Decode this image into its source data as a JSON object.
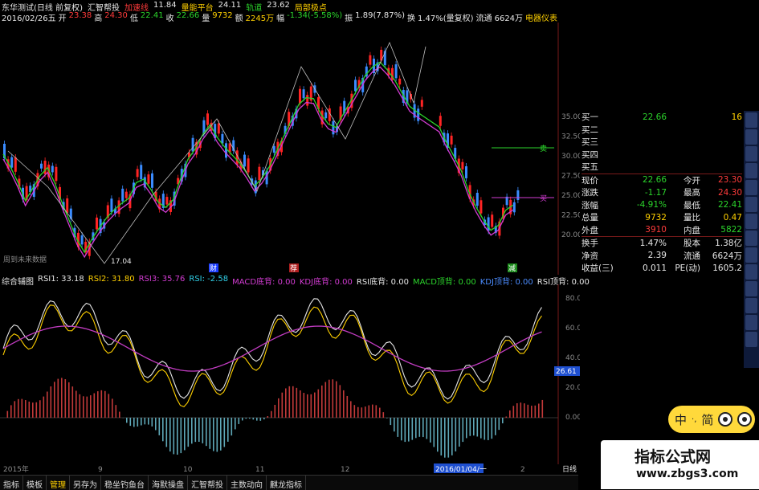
{
  "header": {
    "stock_name": "东华测试(日线 前复权)",
    "menu_hui": "汇智帮投",
    "accel_line_label": "加速线",
    "accel_line_value": "11.84",
    "support_label": "量能平台",
    "support_value": "24.11",
    "track_label": "轨道",
    "track_value": "23.62",
    "local_label": "局部极点",
    "date": "2016/02/26五",
    "open_label": "开",
    "open_value": "23.38",
    "high_label": "高",
    "high_value": "24.30",
    "low_label": "低",
    "low_value": "22.41",
    "close_label": "收",
    "close_value": "22.66",
    "vol_label": "量",
    "vol_value": "9732",
    "amount_label": "额",
    "amount_value": "2245万",
    "change_label": "幅",
    "change_value": "-1.34(-5.58%)",
    "amp_label": "振",
    "amp_value": "1.89(7.87%)",
    "turn_label": "换",
    "turn_value": "1.47%(量复权)",
    "float_label": "流通",
    "float_value": "6624万",
    "meter_label": "电器仪表"
  },
  "main_chart": {
    "low_marker": "17.04",
    "future_data": "周到未来数据",
    "marker_cai": "财",
    "marker_2": "荐",
    "marker_3": "减",
    "y_ticks": [
      "35.00",
      "32.50",
      "30.00",
      "27.50",
      "25.00",
      "22.50",
      "20.00"
    ],
    "label_sell": "卖",
    "label_buy": "买"
  },
  "indicator": {
    "title": "综合辅图",
    "items": [
      {
        "label": "RSI1: 33.18",
        "color": "#e6e6e6"
      },
      {
        "label": "RSI2: 31.80",
        "color": "#ffd000"
      },
      {
        "label": "RSI3: 35.76",
        "color": "#d23cd2"
      },
      {
        "label": "RSI: -2.58",
        "color": "#30d0e8"
      },
      {
        "label": "MACD底背: 0.00",
        "color": "#d23cd2"
      },
      {
        "label": "KDJ底背: 0.00",
        "color": "#d23cd2"
      },
      {
        "label": "RSI底背: 0.00",
        "color": "#e6e6e6"
      },
      {
        "label": "MACD顶背: 0.00",
        "color": "#2bd42b"
      },
      {
        "label": "KDJ顶背: 0.00",
        "color": "#4b8cff"
      },
      {
        "label": "RSI顶背: 0.00",
        "color": "#e6e6e6"
      }
    ],
    "y_ticks": [
      "80.00",
      "60.00",
      "40.00",
      "20.00",
      "0.00"
    ],
    "current_value": "26.61"
  },
  "x_axis": {
    "labels": [
      "2015年",
      "9",
      "10",
      "11",
      "12",
      "2016/01/04/一",
      "2"
    ],
    "period": "日线"
  },
  "quote_panel": {
    "rows": [
      {
        "label": "买一",
        "value": "22.66",
        "value_color": "#2bd42b",
        "mid": "",
        "value2": "16",
        "value2_color": "#ffd000"
      },
      {
        "label": "买二",
        "value": "",
        "value_color": "#e6e6e6",
        "mid": "",
        "value2": "",
        "value2_color": "#e6e6e6"
      },
      {
        "label": "买三",
        "value": "",
        "value_color": "#e6e6e6",
        "mid": "",
        "value2": "",
        "value2_color": "#e6e6e6"
      },
      {
        "label": "买四",
        "value": "",
        "value_color": "#e6e6e6",
        "mid": "",
        "value2": "",
        "value2_color": "#e6e6e6"
      },
      {
        "label": "买五",
        "value": "",
        "value_color": "#e6e6e6",
        "mid": "",
        "value2": "",
        "value2_color": "#e6e6e6"
      },
      {
        "label": "现价",
        "value": "22.66",
        "value_color": "#2bd42b",
        "mid": "今开",
        "value2": "23.30",
        "value2_color": "#ff3b3b"
      },
      {
        "label": "涨跌",
        "value": "-1.17",
        "value_color": "#2bd42b",
        "mid": "最高",
        "value2": "24.30",
        "value2_color": "#ff3b3b"
      },
      {
        "label": "涨幅",
        "value": "-4.91%",
        "value_color": "#2bd42b",
        "mid": "最低",
        "value2": "22.41",
        "value2_color": "#2bd42b"
      },
      {
        "label": "总量",
        "value": "9732",
        "value_color": "#ffd000",
        "mid": "量比",
        "value2": "0.47",
        "value2_color": "#ffd000"
      },
      {
        "label": "外盘",
        "value": "3910",
        "value_color": "#ff3b3b",
        "mid": "内盘",
        "value2": "5822",
        "value2_color": "#2bd42b"
      },
      {
        "label": "换手",
        "value": "1.47%",
        "value_color": "#e6e6e6",
        "mid": "股本",
        "value2": "1.38亿",
        "value2_color": "#e6e6e6"
      },
      {
        "label": "净资",
        "value": "2.39",
        "value_color": "#e6e6e6",
        "mid": "流通",
        "value2": "6624万",
        "value2_color": "#e6e6e6"
      },
      {
        "label": "收益(三)",
        "value": "0.011",
        "value_color": "#e6e6e6",
        "mid": "PE(动)",
        "value2": "1605.2",
        "value2_color": "#e6e6e6"
      }
    ]
  },
  "tabs": [
    "指标",
    "模板",
    "管理",
    "另存为",
    "稳坐钓鱼台",
    "海默操盘",
    "汇智帮投",
    "主数动向",
    "麒龙指标"
  ],
  "active_tab": "管理",
  "widget": {
    "char1": "中",
    "char2": "简"
  },
  "watermark": {
    "title": "指标公式网",
    "url": "www.zbgs3.com"
  }
}
